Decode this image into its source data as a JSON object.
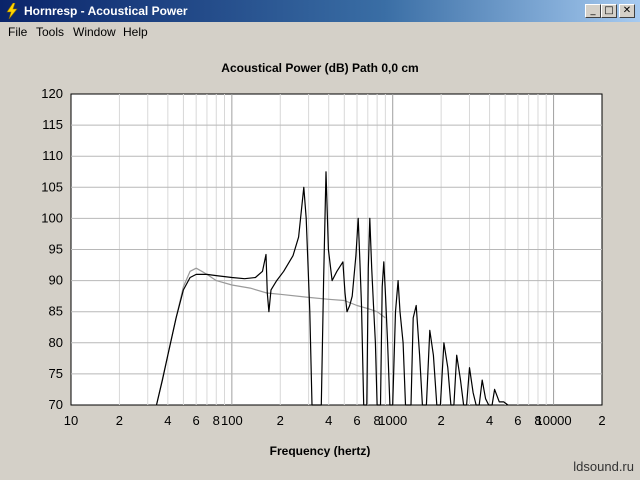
{
  "window": {
    "title": "Hornresp - Acoustical Power",
    "minimize_glyph": "_",
    "maximize_glyph": "□",
    "close_glyph": "✕"
  },
  "menu": [
    "File",
    "Tools",
    "Window",
    "Help"
  ],
  "watermark": "ldsound.ru",
  "chart_data": {
    "type": "line",
    "title": "Acoustical Power (dB)   Path 0,0 cm",
    "xlabel": "Frequency (hertz)",
    "ylabel": "",
    "x_scale": "log",
    "xlim": [
      10,
      20000
    ],
    "ylim": [
      70,
      120
    ],
    "grid": true,
    "y_ticks": [
      120,
      115,
      110,
      105,
      100,
      95,
      90,
      85,
      80,
      75,
      70
    ],
    "x_ticks": [
      {
        "value": 10,
        "label": "10"
      },
      {
        "value": 20,
        "label": "2"
      },
      {
        "value": 40,
        "label": "4"
      },
      {
        "value": 60,
        "label": "6"
      },
      {
        "value": 80,
        "label": "8"
      },
      {
        "value": 100,
        "label": "100"
      },
      {
        "value": 200,
        "label": "2"
      },
      {
        "value": 400,
        "label": "4"
      },
      {
        "value": 600,
        "label": "6"
      },
      {
        "value": 800,
        "label": "8"
      },
      {
        "value": 1000,
        "label": "1000"
      },
      {
        "value": 2000,
        "label": "2"
      },
      {
        "value": 4000,
        "label": "4"
      },
      {
        "value": 6000,
        "label": "6"
      },
      {
        "value": 8000,
        "label": "8"
      },
      {
        "value": 10000,
        "label": "10000"
      },
      {
        "value": 20000,
        "label": "2"
      }
    ],
    "series": [
      {
        "color": "#000000",
        "points": [
          [
            34,
            70
          ],
          [
            37,
            74
          ],
          [
            40,
            78
          ],
          [
            45,
            84
          ],
          [
            50,
            88.5
          ],
          [
            55,
            90.5
          ],
          [
            60,
            91
          ],
          [
            70,
            91
          ],
          [
            80,
            90.8
          ],
          [
            100,
            90.5
          ],
          [
            120,
            90.3
          ],
          [
            140,
            90.5
          ],
          [
            155,
            91.5
          ],
          [
            163,
            94.2
          ],
          [
            166,
            88
          ],
          [
            170,
            85
          ],
          [
            175,
            88.5
          ],
          [
            190,
            90
          ],
          [
            210,
            91.5
          ],
          [
            240,
            94
          ],
          [
            260,
            97
          ],
          [
            280,
            105
          ],
          [
            290,
            100
          ],
          [
            305,
            85
          ],
          [
            315,
            70
          ],
          [
            360,
            70
          ],
          [
            372,
            90
          ],
          [
            385,
            107.5
          ],
          [
            398,
            95
          ],
          [
            420,
            90
          ],
          [
            450,
            91.5
          ],
          [
            490,
            93
          ],
          [
            505,
            88
          ],
          [
            520,
            85
          ],
          [
            540,
            86
          ],
          [
            560,
            87.5
          ],
          [
            590,
            94
          ],
          [
            610,
            100
          ],
          [
            625,
            93
          ],
          [
            640,
            86
          ],
          [
            660,
            70
          ],
          [
            690,
            70
          ],
          [
            705,
            92
          ],
          [
            720,
            100
          ],
          [
            740,
            92
          ],
          [
            760,
            86
          ],
          [
            780,
            80
          ],
          [
            800,
            70
          ],
          [
            840,
            70
          ],
          [
            860,
            89
          ],
          [
            880,
            93
          ],
          [
            900,
            88
          ],
          [
            930,
            80
          ],
          [
            960,
            70
          ],
          [
            1000,
            70
          ],
          [
            1040,
            85
          ],
          [
            1080,
            90
          ],
          [
            1110,
            85
          ],
          [
            1160,
            80
          ],
          [
            1200,
            70
          ],
          [
            1300,
            70
          ],
          [
            1340,
            84
          ],
          [
            1400,
            86
          ],
          [
            1470,
            78
          ],
          [
            1530,
            70
          ],
          [
            1620,
            70
          ],
          [
            1700,
            82
          ],
          [
            1790,
            78
          ],
          [
            1880,
            70
          ],
          [
            1980,
            70
          ],
          [
            2080,
            80
          ],
          [
            2200,
            76
          ],
          [
            2300,
            70
          ],
          [
            2400,
            70
          ],
          [
            2500,
            78
          ],
          [
            2640,
            74
          ],
          [
            2760,
            70
          ],
          [
            2880,
            70
          ],
          [
            3000,
            76
          ],
          [
            3160,
            72
          ],
          [
            3300,
            70
          ],
          [
            3450,
            70
          ],
          [
            3600,
            74
          ],
          [
            3780,
            71
          ],
          [
            3950,
            70
          ],
          [
            4150,
            70
          ],
          [
            4300,
            72.5
          ],
          [
            4600,
            70.5
          ],
          [
            4900,
            70.5
          ],
          [
            5200,
            70
          ]
        ]
      },
      {
        "color": "#9a9a9a",
        "points": [
          [
            34,
            70
          ],
          [
            40,
            78
          ],
          [
            45,
            84
          ],
          [
            50,
            89
          ],
          [
            55,
            91.5
          ],
          [
            60,
            92
          ],
          [
            65,
            91.5
          ],
          [
            70,
            91
          ],
          [
            80,
            90
          ],
          [
            100,
            89.3
          ],
          [
            130,
            88.8
          ],
          [
            165,
            88
          ],
          [
            200,
            87.8
          ],
          [
            300,
            87.3
          ],
          [
            400,
            87
          ],
          [
            500,
            86.8
          ],
          [
            600,
            86
          ],
          [
            700,
            85.5
          ],
          [
            800,
            85
          ],
          [
            900,
            84
          ]
        ]
      }
    ]
  }
}
